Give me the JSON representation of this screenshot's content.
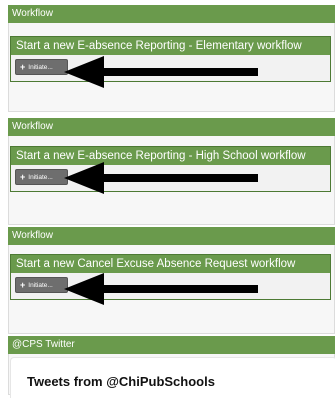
{
  "panels": [
    {
      "header": "Workflow",
      "workflow_title": "Start a new E-absence Reporting - Elementary workflow",
      "button_label": "Initiate..."
    },
    {
      "header": "Workflow",
      "workflow_title": "Start a new E-absence Reporting - High School workflow",
      "button_label": "Initiate..."
    },
    {
      "header": "Workflow",
      "workflow_title": "Start a new Cancel Excuse Absence Request workflow",
      "button_label": "Initiate..."
    }
  ],
  "twitter": {
    "header": "@CPS Twitter",
    "title": "Tweets from @ChiPubSchools"
  },
  "icons": {
    "plus": "+",
    "arrow": "left-arrow-icon"
  },
  "colors": {
    "header_green": "#6a9a4c",
    "button_gray": "#6e6e6e"
  }
}
